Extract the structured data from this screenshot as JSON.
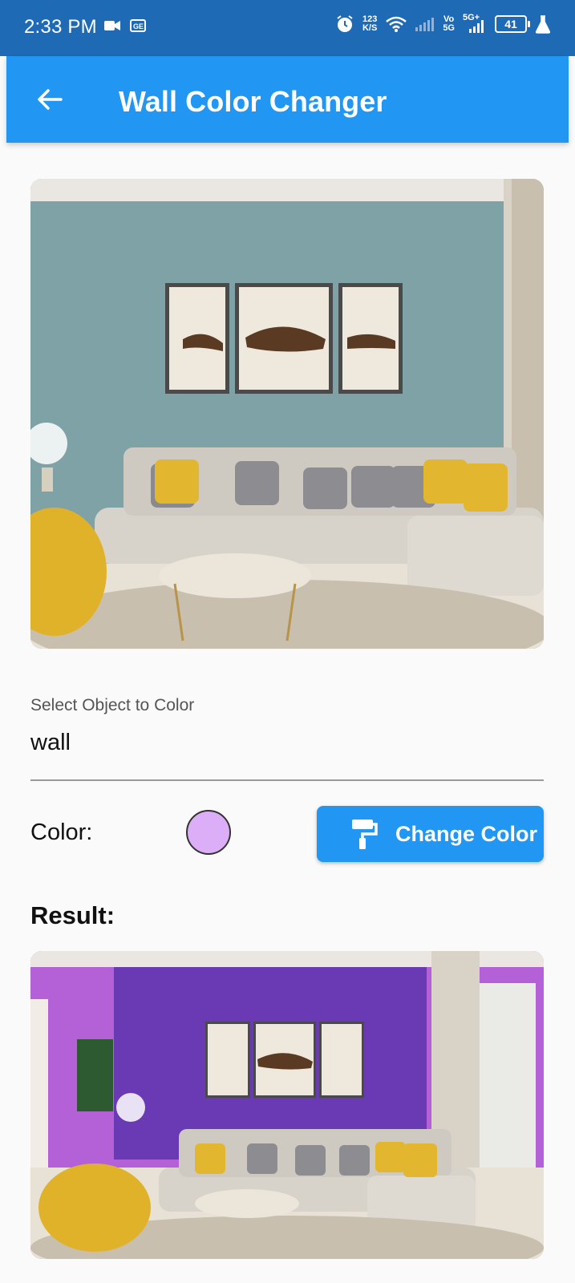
{
  "status_bar": {
    "time": "2:33 PM",
    "net_speed_top": "123",
    "net_speed_bottom": "K/S",
    "volte_top": "Vo",
    "volte_bottom": "5G",
    "network": "5G+",
    "battery": "41"
  },
  "app_bar": {
    "title": "Wall Color Changer"
  },
  "images": {
    "original_wall_color": "#7fa2a6",
    "result_wall_color": "#6a3ab4",
    "result_side_wall_color": "#b460d6"
  },
  "selector": {
    "label": "Select Object to Color",
    "value": "wall"
  },
  "color_row": {
    "label": "Color:",
    "selected_color": "#dcaef8",
    "button_label": "Change Color"
  },
  "result": {
    "label": "Result:"
  },
  "colors": {
    "primary": "#2196f3",
    "status_bar": "#1f6ab5"
  }
}
